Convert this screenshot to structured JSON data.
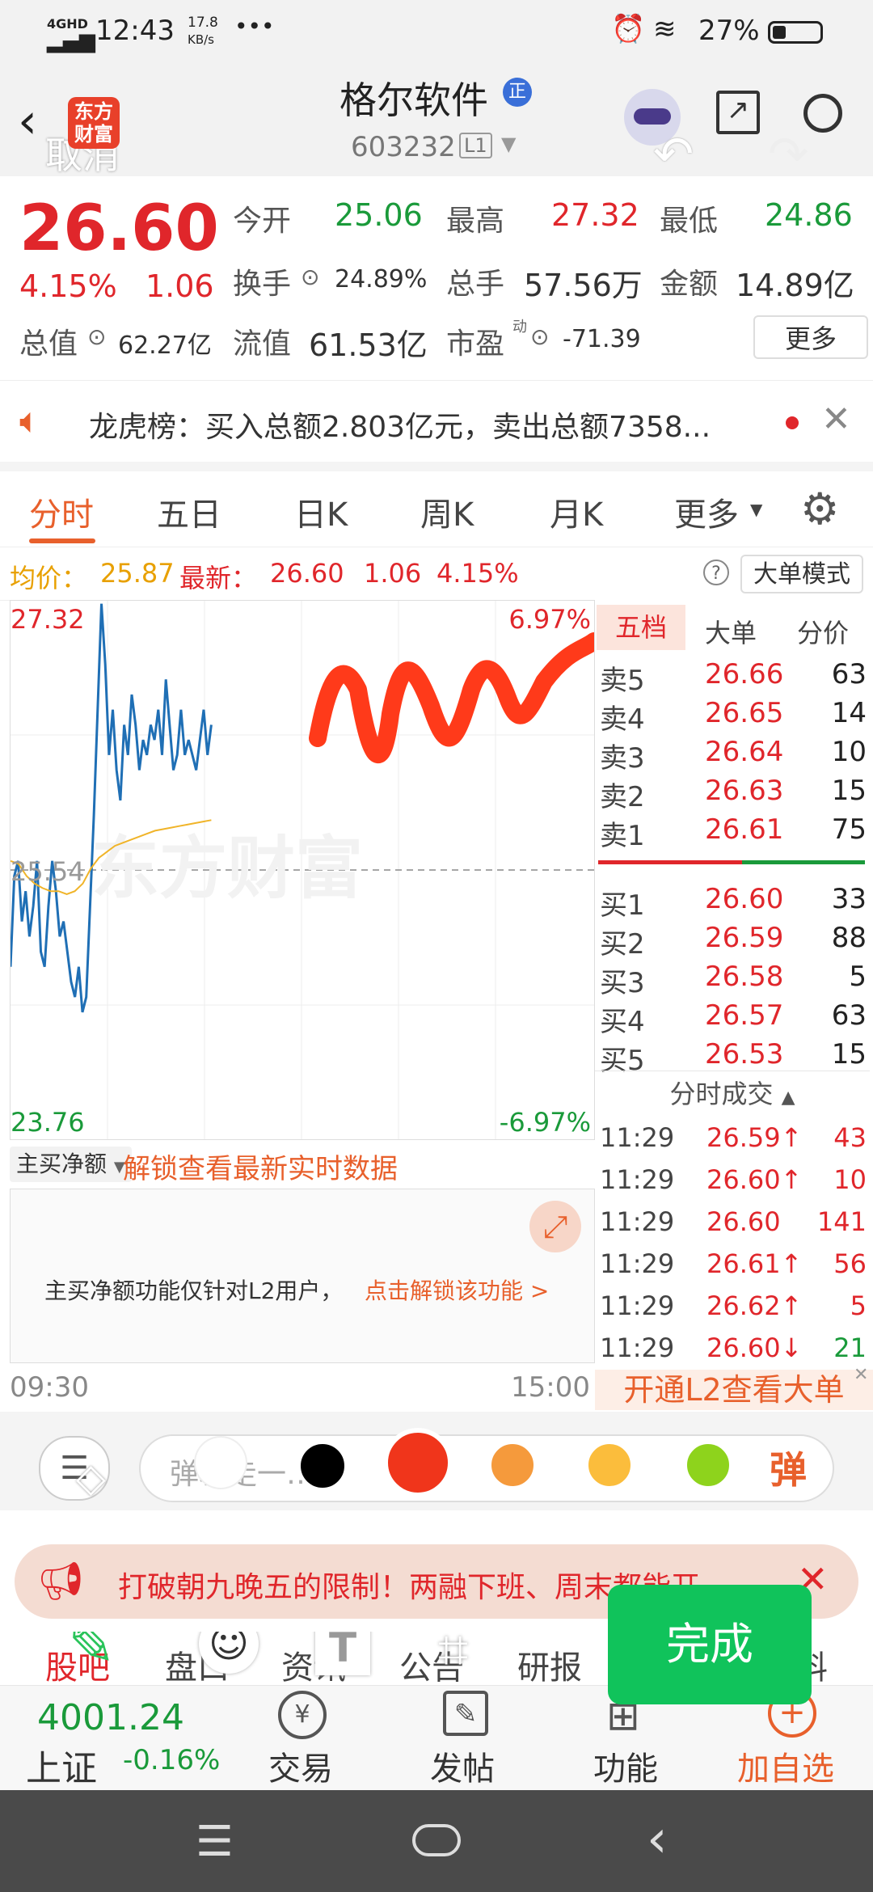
{
  "status_bar": {
    "network": "4GHD",
    "time": "12:43",
    "speed": "17.8",
    "speed_unit": "KB/s",
    "more": "•••",
    "battery": "27%"
  },
  "header": {
    "logo_text": "东方财富",
    "title": "格尔软件",
    "title_badge": "正",
    "code": "603232",
    "level_badge": "L1",
    "cancel_overlay": "取消"
  },
  "quote": {
    "price": "26.60",
    "change_pct": "4.15%",
    "change": "1.06",
    "open_label": "今开",
    "open": "25.06",
    "high_label": "最高",
    "high": "27.32",
    "low_label": "最低",
    "low": "24.86",
    "turnover_label": "换手",
    "turnover": "24.89%",
    "volume_label": "总手",
    "volume": "57.56万",
    "amount_label": "金额",
    "amount": "14.89亿",
    "mcap_label": "总值",
    "mcap": "62.27亿",
    "float_label": "流值",
    "float": "61.53亿",
    "pe_label": "市盈",
    "pe_sup": "动",
    "pe": "-71.39",
    "more_button": "更多"
  },
  "lhb": {
    "text": "龙虎榜：买入总额2.803亿元，卖出总额7358..."
  },
  "tabs": {
    "items": [
      "分时",
      "五日",
      "日K",
      "周K",
      "月K",
      "更多"
    ],
    "active": 0
  },
  "info_row": {
    "avg_label": "均价：",
    "avg": "25.87",
    "latest_label": "最新：",
    "latest": "26.60",
    "latest_change": "1.06",
    "latest_pct": "4.15%",
    "mode_button": "大单模式"
  },
  "chart_data": {
    "type": "line",
    "y_max_label": "27.32",
    "y_min_label": "23.76",
    "y_mid_label": "25.54",
    "pct_max_label": "6.97%",
    "pct_min_label": "-6.97%",
    "x_start": "09:30",
    "x_end": "15:00",
    "ylim": [
      23.76,
      27.32
    ],
    "watermark": "东方财富",
    "series": [
      {
        "values": [
          24.9,
          25.5,
          25.6,
          25.2,
          25.4,
          25.1,
          25.3,
          25.6,
          25.0,
          24.9,
          25.3,
          25.6,
          25.4,
          25.1,
          25.2,
          25.0,
          24.8,
          24.7,
          24.9,
          24.6,
          24.7,
          25.3,
          25.9,
          26.6,
          27.3,
          26.9,
          26.3,
          26.6,
          26.2,
          26.0,
          26.5,
          26.3,
          26.7,
          26.5,
          26.2,
          26.4,
          26.3,
          26.5,
          26.4,
          26.6,
          26.3,
          26.8,
          26.5,
          26.2,
          26.3,
          26.6,
          26.3,
          26.4,
          26.3,
          26.2,
          26.4,
          26.6,
          26.3,
          26.5
        ]
      },
      {
        "values": [
          25.6,
          25.58,
          25.5,
          25.45,
          25.42,
          25.4,
          25.4,
          25.38,
          25.4,
          25.45,
          25.55,
          25.62,
          25.66,
          25.7,
          25.72,
          25.74,
          25.76,
          25.78,
          25.8,
          25.81,
          25.82,
          25.83,
          25.84,
          25.85,
          25.86,
          25.87
        ]
      }
    ],
    "prev_close": 25.54,
    "highlight_color": "#ff3a1a"
  },
  "order_book": {
    "tabs": [
      "五档",
      "大单",
      "分价"
    ],
    "asks": [
      {
        "label": "卖5",
        "price": "26.66",
        "vol": "63"
      },
      {
        "label": "卖4",
        "price": "26.65",
        "vol": "14"
      },
      {
        "label": "卖3",
        "price": "26.64",
        "vol": "10"
      },
      {
        "label": "卖2",
        "price": "26.63",
        "vol": "15"
      },
      {
        "label": "卖1",
        "price": "26.61",
        "vol": "75"
      }
    ],
    "bids": [
      {
        "label": "买1",
        "price": "26.60",
        "vol": "33"
      },
      {
        "label": "买2",
        "price": "26.59",
        "vol": "88"
      },
      {
        "label": "买3",
        "price": "26.58",
        "vol": "5"
      },
      {
        "label": "买4",
        "price": "26.57",
        "vol": "63"
      },
      {
        "label": "买5",
        "price": "26.53",
        "vol": "15"
      }
    ],
    "trades_title": "分时成交",
    "trades": [
      {
        "time": "11:29",
        "price": "26.59↑",
        "vol": "43",
        "dir": "up"
      },
      {
        "time": "11:29",
        "price": "26.60↑",
        "vol": "10",
        "dir": "up"
      },
      {
        "time": "11:29",
        "price": "26.60",
        "vol": "141",
        "dir": "none"
      },
      {
        "time": "11:29",
        "price": "26.61↑",
        "vol": "56",
        "dir": "up"
      },
      {
        "time": "11:29",
        "price": "26.62↑",
        "vol": "5",
        "dir": "up"
      },
      {
        "time": "11:29",
        "price": "26.60↓",
        "vol": "21",
        "dir": "down"
      }
    ],
    "l2_link": "开通L2查看大单"
  },
  "sub_panel": {
    "selector": "主买净额",
    "unlock_link": "解锁查看最新实时数据",
    "notice": "主买净额功能仅针对L2用户，",
    "notice_link": "点击解锁该功能 >"
  },
  "toolbar": {
    "comment_placeholder": "弹幕走一…",
    "done_button": "完成",
    "colors": [
      "#ffffff",
      "#000000",
      "#f0351b",
      "#f59a3c",
      "#fbbd3c",
      "#8ed31c"
    ]
  },
  "banner": {
    "text": "打破朝九晚五的限制！两融下班、周末都能开"
  },
  "bottom_tabs": [
    "股吧",
    "盘口",
    "资讯",
    "公告",
    "研报",
    "资料"
  ],
  "bottom_nav": {
    "index_value": "4001.24",
    "index_name": "上证",
    "index_change": "-0.16%",
    "items": [
      "交易",
      "发帖",
      "功能",
      "加自选"
    ]
  }
}
